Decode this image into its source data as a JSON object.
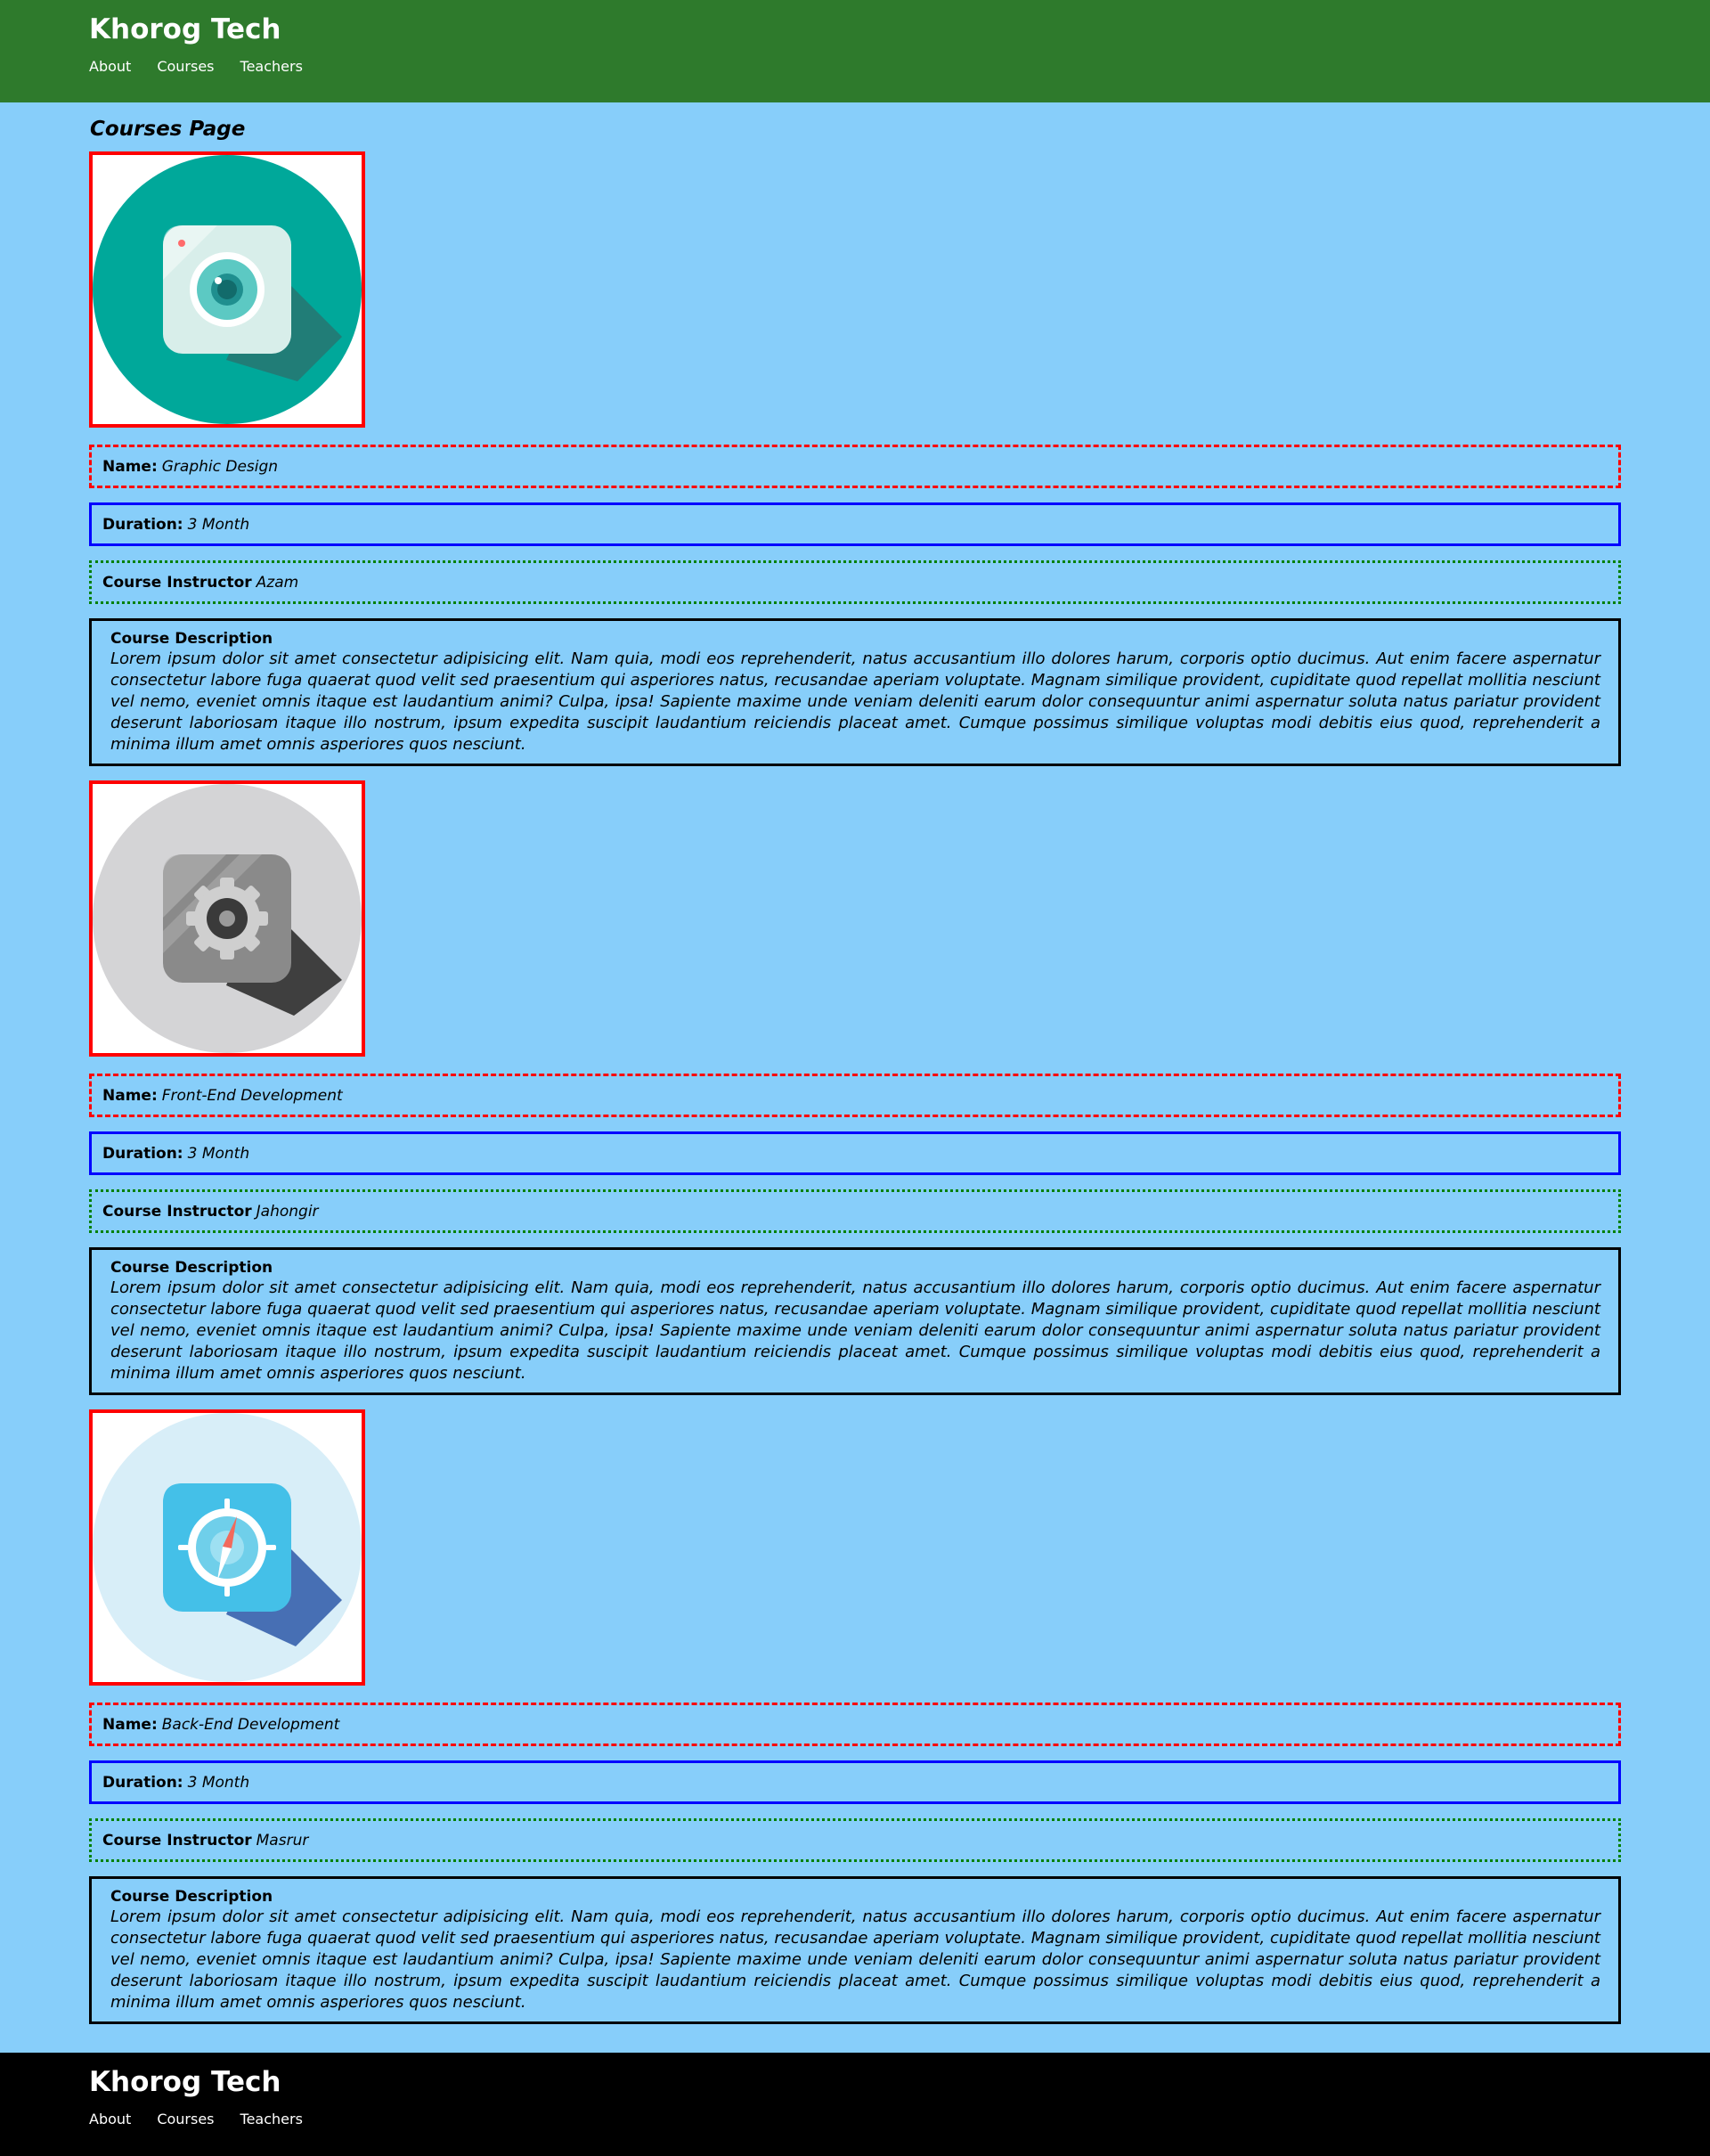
{
  "site": {
    "brand": "Khorog Tech",
    "nav": [
      "About",
      "Courses",
      "Teachers"
    ]
  },
  "page": {
    "title": "Courses Page"
  },
  "labels": {
    "name": "Name:",
    "duration": "Duration:",
    "instructor": "Course Instructor",
    "description": "Course Description"
  },
  "courses": [
    {
      "icon": "camera-icon",
      "name": "Graphic Design",
      "duration": "3 Month",
      "instructor": "Azam",
      "description": "Lorem ipsum dolor sit amet consectetur adipisicing elit. Nam quia, modi eos reprehenderit, natus accusantium illo dolores harum, corporis optio ducimus. Aut enim facere aspernatur consectetur labore fuga quaerat quod velit sed praesentium qui asperiores natus, recusandae aperiam voluptate. Magnam similique provident, cupiditate quod repellat mollitia nesciunt vel nemo, eveniet omnis itaque est laudantium animi? Culpa, ipsa! Sapiente maxime unde veniam deleniti earum dolor consequuntur animi aspernatur soluta natus pariatur provident deserunt laboriosam itaque illo nostrum, ipsum expedita suscipit laudantium reiciendis placeat amet. Cumque possimus similique voluptas modi debitis eius quod, reprehenderit a minima illum amet omnis asperiores quos nesciunt."
    },
    {
      "icon": "settings-gear-icon",
      "name": "Front-End Development",
      "duration": "3 Month",
      "instructor": "Jahongir",
      "description": "Lorem ipsum dolor sit amet consectetur adipisicing elit. Nam quia, modi eos reprehenderit, natus accusantium illo dolores harum, corporis optio ducimus. Aut enim facere aspernatur consectetur labore fuga quaerat quod velit sed praesentium qui asperiores natus, recusandae aperiam voluptate. Magnam similique provident, cupiditate quod repellat mollitia nesciunt vel nemo, eveniet omnis itaque est laudantium animi? Culpa, ipsa! Sapiente maxime unde veniam deleniti earum dolor consequuntur animi aspernatur soluta natus pariatur provident deserunt laboriosam itaque illo nostrum, ipsum expedita suscipit laudantium reiciendis placeat amet. Cumque possimus similique voluptas modi debitis eius quod, reprehenderit a minima illum amet omnis asperiores quos nesciunt."
    },
    {
      "icon": "compass-icon",
      "name": "Back-End Development",
      "duration": "3 Month",
      "instructor": "Masrur",
      "description": "Lorem ipsum dolor sit amet consectetur adipisicing elit. Nam quia, modi eos reprehenderit, natus accusantium illo dolores harum, corporis optio ducimus. Aut enim facere aspernatur consectetur labore fuga quaerat quod velit sed praesentium qui asperiores natus, recusandae aperiam voluptate. Magnam similique provident, cupiditate quod repellat mollitia nesciunt vel nemo, eveniet omnis itaque est laudantium animi? Culpa, ipsa! Sapiente maxime unde veniam deleniti earum dolor consequuntur animi aspernatur soluta natus pariatur provident deserunt laboriosam itaque illo nostrum, ipsum expedita suscipit laudantium reiciendis placeat amet. Cumque possimus similique voluptas modi debitis eius quod, reprehenderit a minima illum amet omnis asperiores quos nesciunt."
    }
  ],
  "colors": {
    "header_bg": "#2e7a2c",
    "page_bg": "#87cefa",
    "footer_bg": "#000000",
    "image_border": "#ff0000",
    "name_border": "#ff0000",
    "duration_border": "#0000ff",
    "instructor_border": "#008000"
  }
}
